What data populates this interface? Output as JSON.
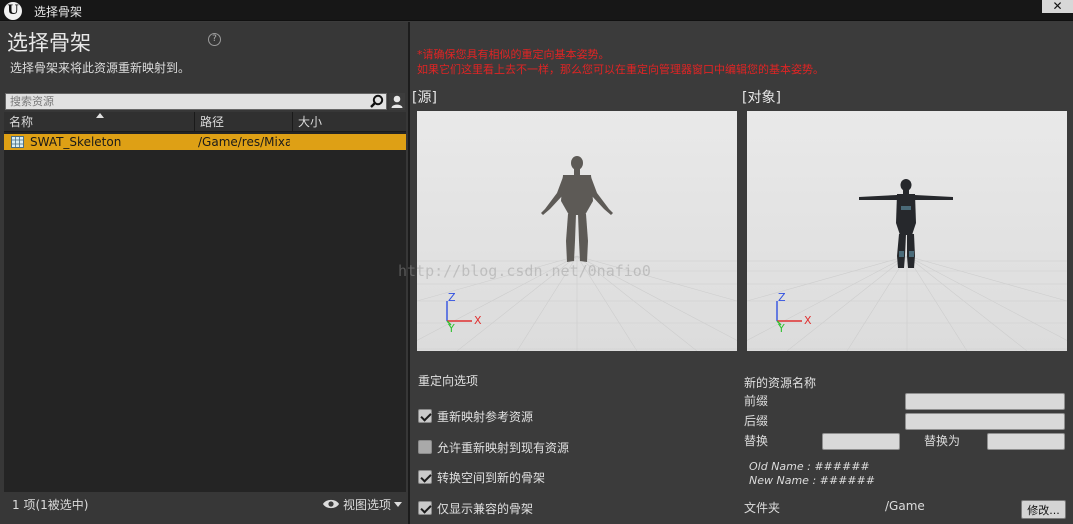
{
  "window": {
    "title": "选择骨架",
    "logo_text": "U",
    "close_glyph": "✕"
  },
  "left": {
    "heading": "选择骨架",
    "help_glyph": "?",
    "subheading": "选择骨架来将此资源重新映射到。",
    "search": {
      "placeholder": "搜索资源",
      "value": ""
    },
    "columns": [
      "名称",
      "路径",
      "大小"
    ],
    "sort": {
      "column": "名称",
      "direction": "ascending"
    },
    "rows": [
      {
        "name": "SWAT_Skeleton",
        "path": "/Game/res/Mixamo",
        "size": "",
        "selected": true,
        "icon": "skeleton-asset-icon"
      }
    ],
    "status": "1 项(1被选中)",
    "view_options": "视图选项"
  },
  "right": {
    "warning_line1": "*请确保您具有相似的重定向基本姿势。",
    "warning_line2": "如果它们这里看上去不一样，那么您可以在重定向管理器窗口中编辑您的基本姿势。",
    "source_label": "[源]",
    "target_label": "[对象]",
    "axis": {
      "z": "Z",
      "y": "Y",
      "x": "X"
    },
    "watermark": "http://blog.csdn.net/0nafio0",
    "retarget_options": {
      "title": "重定向选项",
      "items": [
        {
          "label": "重新映射参考资源",
          "checked": true
        },
        {
          "label": "允许重新映射到现有资源",
          "checked": false
        },
        {
          "label": "转换空间到新的骨架",
          "checked": true
        },
        {
          "label": "仅显示兼容的骨架",
          "checked": true
        }
      ]
    },
    "new_asset_name": {
      "title": "新的资源名称",
      "prefix_label": "前缀",
      "prefix_value": "",
      "suffix_label": "后缀",
      "suffix_value": "",
      "replace_label": "替换",
      "replace_value": "",
      "replace_with_label": "替换为",
      "replace_with_value": "",
      "old_name": "Old Name : ######",
      "new_name": "New Name : ######"
    },
    "folder": {
      "label": "文件夹",
      "value": "/Game",
      "button": "修改..."
    }
  },
  "colors": {
    "selection": "#dea015",
    "warning": "#e02424",
    "axis_x": "#e03030",
    "axis_y": "#30c030",
    "axis_z": "#3050e0"
  }
}
